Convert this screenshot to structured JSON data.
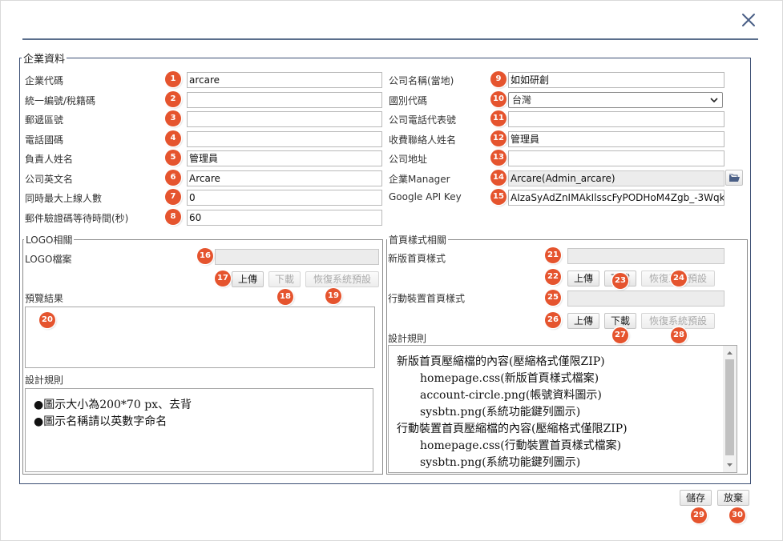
{
  "dialog": {
    "close_symbol": "✕"
  },
  "company": {
    "legend": "企業資料",
    "left_fields": [
      {
        "label": "企業代碼",
        "badge": "1",
        "value": "arcare"
      },
      {
        "label": "統一編號/稅籍碼",
        "badge": "2",
        "value": ""
      },
      {
        "label": "郵遞區號",
        "badge": "3",
        "value": ""
      },
      {
        "label": "電話國碼",
        "badge": "4",
        "value": ""
      },
      {
        "label": "負責人姓名",
        "badge": "5",
        "value": "管理員"
      },
      {
        "label": "公司英文名",
        "badge": "6",
        "value": "Arcare"
      },
      {
        "label": "同時最大上線人數",
        "badge": "7",
        "value": "0"
      },
      {
        "label": "郵件驗證碼等待時間(秒)",
        "badge": "8",
        "value": "60"
      }
    ],
    "right_fields": [
      {
        "label": "公司名稱(當地)",
        "badge": "9",
        "value": "如如研創"
      },
      {
        "label": "國別代碼",
        "badge": "10",
        "value": "台灣"
      },
      {
        "label": "公司電話代表號",
        "badge": "11",
        "value": ""
      },
      {
        "label": "收費聯絡人姓名",
        "badge": "12",
        "value": "管理員"
      },
      {
        "label": "公司地址",
        "badge": "13",
        "value": ""
      },
      {
        "label": "企業Manager",
        "badge": "14",
        "value": "Arcare(Admin_arcare)"
      },
      {
        "label": "Google API Key",
        "badge": "15",
        "value": "AIzaSyAdZnIMAkIlsscFyPODHoM4Zgb_-3Wqk"
      }
    ]
  },
  "logo": {
    "legend": "LOGO相關",
    "file_label": "LOGO檔案",
    "file_badge": "16",
    "upload_label": "上傳",
    "upload_badge": "17",
    "download_label": "下載",
    "download_badge": "18",
    "restore_label": "恢復系統預設",
    "restore_badge": "19",
    "preview_label": "預覽結果",
    "preview_badge": "20",
    "rules_label": "設計規則",
    "rules": [
      "●圖示大小為200*70 px、去背",
      "●圖示名稱請以英數字命名"
    ]
  },
  "homepage": {
    "legend": "首頁樣式相關",
    "new_label": "新版首頁樣式",
    "new_badge": "21",
    "new_upload_label": "上傳",
    "new_upload_badge": "22",
    "new_download_label": "下載",
    "new_download_badge": "23",
    "new_restore_label": "恢復系統預設",
    "new_restore_badge": "24",
    "mobile_label": "行動裝置首頁樣式",
    "mobile_badge": "25",
    "mobile_upload_label": "上傳",
    "mobile_upload_badge": "26",
    "mobile_download_label": "下載",
    "mobile_download_badge": "27",
    "mobile_restore_label": "恢復系統預設",
    "mobile_restore_badge": "28",
    "rules_label": "設計規則",
    "rules": [
      {
        "text": "新版首頁壓縮檔的內容(壓縮格式僅限ZIP)",
        "indent": false
      },
      {
        "text": "homepage.css(新版首頁樣式檔案)",
        "indent": true
      },
      {
        "text": "account-circle.png(帳號資料圖示)",
        "indent": true
      },
      {
        "text": "sysbtn.png(系統功能鍵列圖示)",
        "indent": true
      },
      {
        "text": "行動裝置首頁壓縮檔的內容(壓縮格式僅限ZIP)",
        "indent": false
      },
      {
        "text": "homepage.css(行動裝置首頁樣式檔案)",
        "indent": true
      },
      {
        "text": "sysbtn.png(系統功能鍵列圖示)",
        "indent": true
      }
    ]
  },
  "footer": {
    "save_label": "儲存",
    "save_badge": "29",
    "cancel_label": "放棄",
    "cancel_badge": "30"
  },
  "icons": {
    "close": "close-icon",
    "folder": "folder-open-icon",
    "dropdown": "chevron-down-icon"
  },
  "colors": {
    "badge": "#e5542e",
    "frame": "#3b4e73",
    "close": "#4a5f86"
  }
}
